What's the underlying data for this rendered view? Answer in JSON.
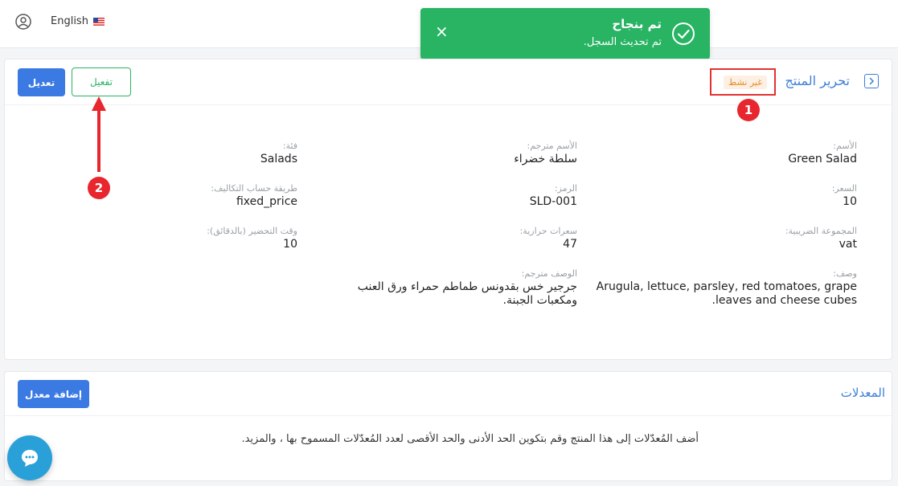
{
  "topbar": {
    "language": "English"
  },
  "toast": {
    "title": "تم بنجاح",
    "message": "تم تحديث السجل.",
    "close": "×"
  },
  "product": {
    "title": "تحرير المنتج",
    "status": "غير نشط",
    "edit_label": "تعديل",
    "activate_label": "تفعيل",
    "fields": {
      "name": {
        "label": "الأسم:",
        "value": "Green Salad"
      },
      "name_translated": {
        "label": "الأسم مترجم:",
        "value": "سلطة خضراء"
      },
      "category": {
        "label": "فئة:",
        "value": "Salads"
      },
      "price": {
        "label": "السعر:",
        "value": "10"
      },
      "code": {
        "label": "الرمز:",
        "value": "SLD-001"
      },
      "costing_method": {
        "label": "طريقة حساب التكاليف:",
        "value": "fixed_price"
      },
      "tax_group": {
        "label": "المجموعة الضريبية:",
        "value": "vat"
      },
      "calories": {
        "label": "سعرات حرارية:",
        "value": "47"
      },
      "prep_time": {
        "label": "وقت التحضير (بالدقائق):",
        "value": "10"
      },
      "description": {
        "label": "وصف:",
        "value": "Arugula, lettuce, parsley, red tomatoes, grape leaves and cheese cubes."
      },
      "description_translated": {
        "label": "الوصف مترجم:",
        "value": "جرجير خس بقدونس طماطم حمراء ورق العنب ومكعبات الجبنة."
      }
    }
  },
  "annotations": {
    "marker1": "1",
    "marker2": "2",
    "color": "#e8262d"
  },
  "modifiers": {
    "title": "المعدلات",
    "add_label": "إضافة معدل",
    "description": "أضف المُعدّلات إلى هذا المنتج وقم بتكوين الحد الأدنى والحد الأقصى لعدد المُعدّلات المسموح بها ، والمزيد."
  },
  "colors": {
    "primary": "#3b7ae3",
    "success": "#28b463",
    "warning": "#e38c2a"
  },
  "icons": {
    "user": "user-icon",
    "flag": "us-flag-icon",
    "check": "check-circle-icon",
    "back": "chevron-right-icon",
    "chat": "chat-icon"
  }
}
